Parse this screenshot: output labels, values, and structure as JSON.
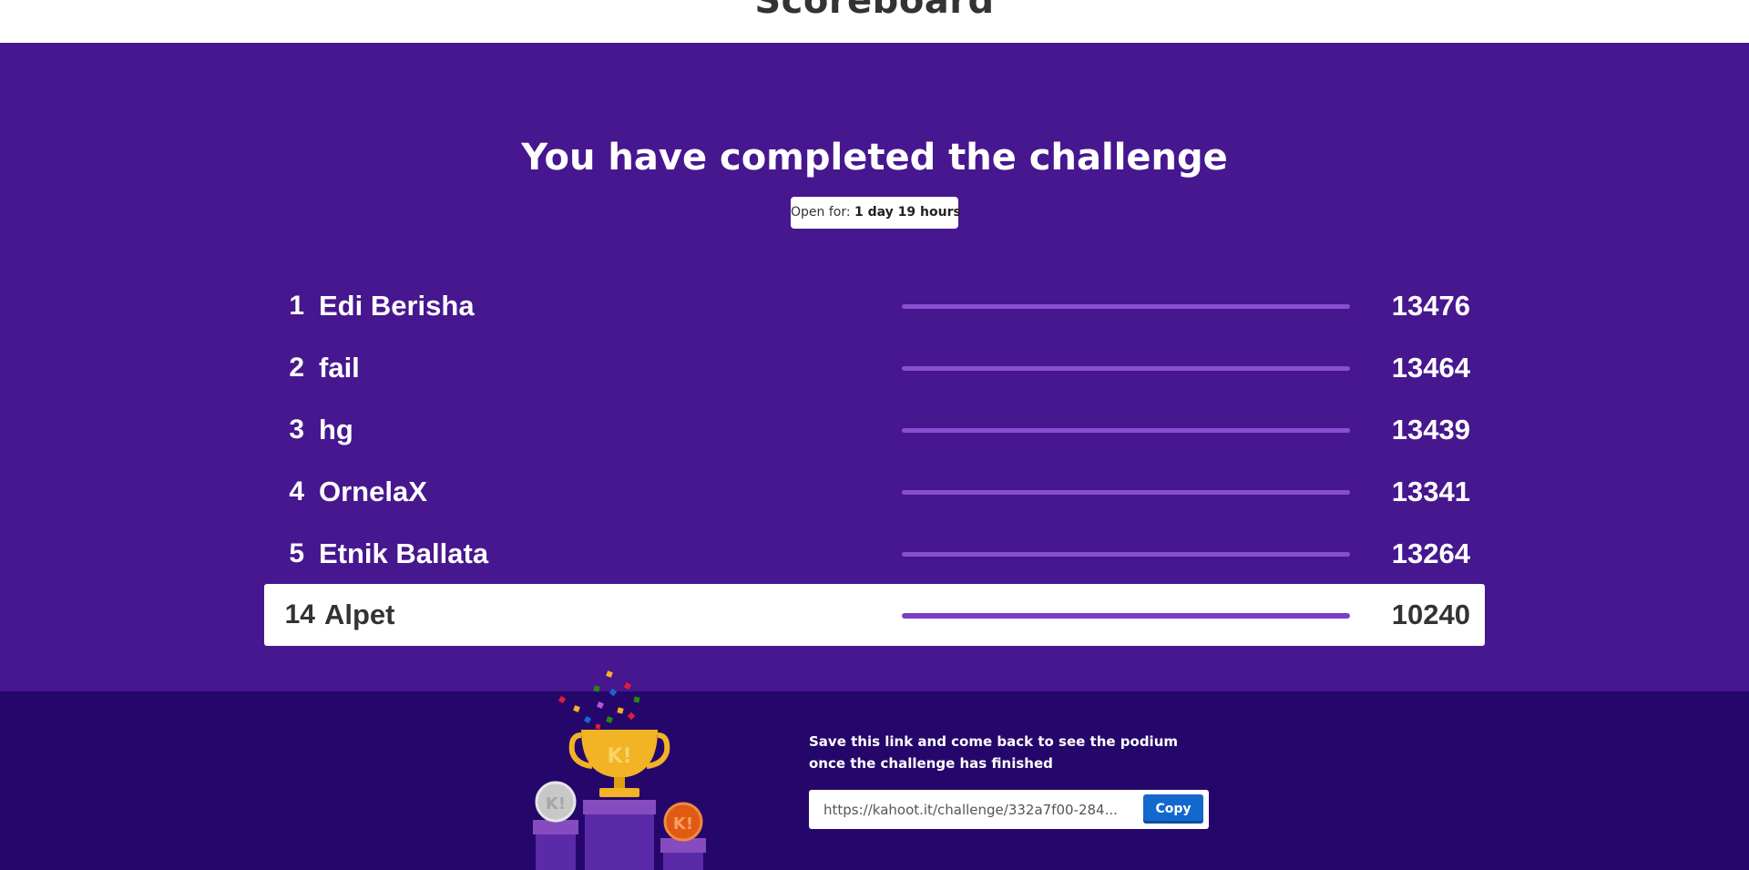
{
  "header": {
    "title": "Scoreboard"
  },
  "challenge": {
    "headline": "You have completed the challenge",
    "open_label": "Open for:",
    "open_value": "1 day 19 hours"
  },
  "scoreboard": {
    "rows": [
      {
        "rank": "1",
        "name": "Edi Berisha",
        "score": "13476",
        "bar_fraction": 1.0
      },
      {
        "rank": "2",
        "name": "fail",
        "score": "13464",
        "bar_fraction": 1.0
      },
      {
        "rank": "3",
        "name": "hg",
        "score": "13439",
        "bar_fraction": 1.0
      },
      {
        "rank": "4",
        "name": "OrnelaX",
        "score": "13341",
        "bar_fraction": 1.0
      },
      {
        "rank": "5",
        "name": "Etnik Ballata",
        "score": "13264",
        "bar_fraction": 1.0
      }
    ],
    "current_player": {
      "rank": "14",
      "name": "Alpet",
      "score": "10240",
      "bar_fraction": 1.0
    }
  },
  "footer": {
    "save_text": "Save this link and come back to see the podium once the challenge has finished",
    "link_value": "https://kahoot.it/challenge/332a7f00-284...",
    "copy_label": "Copy",
    "trophy_letter": "K!",
    "medal_letter": "K!"
  },
  "colors": {
    "main_bg": "#46178f",
    "footer_bg": "#25076b",
    "bar": "#8a4ed0",
    "copy_button": "#1368ce",
    "gold": "#f2b324",
    "silver": "#c8c8c8",
    "bronze": "#e05a13"
  }
}
